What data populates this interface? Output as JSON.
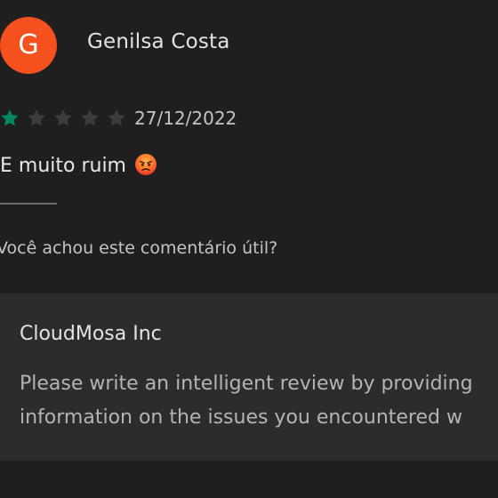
{
  "review": {
    "avatar_letter": "G",
    "avatar_color": "#f4511e",
    "author": "Genilsa Costa",
    "rating": 1,
    "max_rating": 5,
    "star_filled_color": "#01875f",
    "star_empty_color": "#3c3c3c",
    "date": "27/12/2022",
    "text": "E muito ruim",
    "emoji": "angry-face-emoji",
    "helpful_prompt": "Você achou este comentário útil?"
  },
  "developer_reply": {
    "author": "CloudMosa Inc",
    "lines": [
      "Please write an intelligent review by providing",
      "information on the issues you encountered w"
    ]
  }
}
